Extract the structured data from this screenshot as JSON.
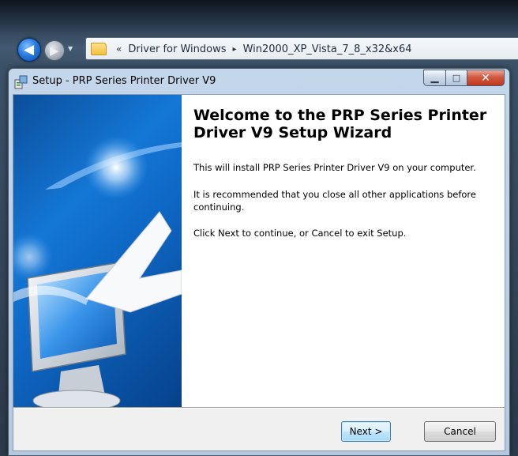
{
  "explorer": {
    "breadcrumb_chevrons": "«",
    "breadcrumb": [
      "Driver for Windows",
      "Win2000_XP_Vista_7_8_x32&x64"
    ],
    "separator_glyph": "▸",
    "back_glyph": "◀",
    "forward_glyph": "▶",
    "dropdown_glyph": "▼"
  },
  "window": {
    "title": "Setup - PRP Series Printer Driver V9",
    "controls": {
      "minimize": "▁",
      "maximize": "□",
      "close": "✕"
    }
  },
  "wizard": {
    "heading": "Welcome to the PRP Series Printer Driver V9 Setup Wizard",
    "paragraphs": {
      "install": "This will install PRP Series Printer Driver V9 on your computer.",
      "recommend": "It is recommended that you close all other applications before continuing.",
      "continue": "Click Next to continue, or Cancel to exit Setup."
    }
  },
  "buttons": {
    "next": "Next >",
    "cancel": "Cancel"
  },
  "colors": {
    "panel_blue": "#1477d6",
    "close_red": "#c0361e",
    "next_border": "#3c7fb1"
  },
  "icons": {
    "back": "back-arrow-icon",
    "forward": "forward-arrow-icon",
    "folder": "folder-icon",
    "app": "setup-app-icon",
    "side_art": "monitor-arrow-illustration"
  }
}
